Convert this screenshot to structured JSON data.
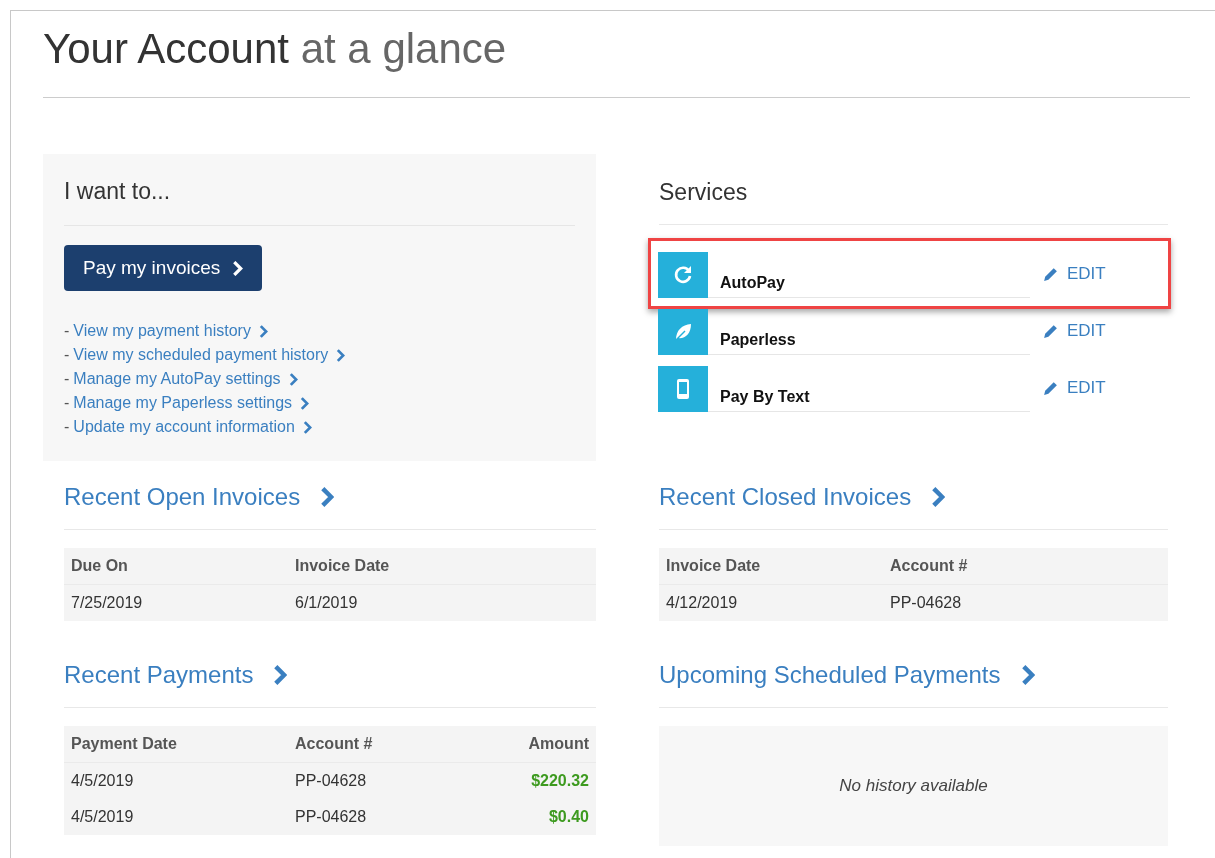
{
  "title": {
    "main": "Your Account",
    "rest": "at a glance"
  },
  "actions": {
    "heading": "I want to...",
    "primary_button": "Pay my invoices",
    "links": [
      {
        "prefix": "-",
        "label": "View my payment history"
      },
      {
        "prefix": "-",
        "label": "View my scheduled payment history"
      },
      {
        "prefix": "-",
        "label": "Manage my AutoPay settings"
      },
      {
        "prefix": "-",
        "label": "Manage my Paperless settings"
      },
      {
        "prefix": "-",
        "label": "Update my account information"
      }
    ]
  },
  "services": {
    "heading": "Services",
    "items": [
      {
        "kind": "refresh",
        "name": "AutoPay",
        "action": "EDIT",
        "highlighted": true
      },
      {
        "kind": "leaf",
        "name": "Paperless",
        "action": "EDIT",
        "highlighted": false
      },
      {
        "kind": "phone",
        "name": "Pay By Text",
        "action": "EDIT",
        "highlighted": false
      }
    ]
  },
  "sections": [
    {
      "title": "Recent Open Invoices",
      "columns": [
        {
          "label": "Due On",
          "kind": "text"
        },
        {
          "label": "Invoice Date",
          "kind": "text"
        }
      ],
      "rows": [
        [
          "7/25/2019",
          "6/1/2019"
        ]
      ]
    },
    {
      "title": "Recent Closed Invoices",
      "columns": [
        {
          "label": "Invoice Date",
          "kind": "text"
        },
        {
          "label": "Account #",
          "kind": "text"
        }
      ],
      "rows": [
        [
          "4/12/2019",
          "PP-04628"
        ]
      ]
    },
    {
      "title": "Recent Payments",
      "columns": [
        {
          "label": "Payment Date",
          "kind": "text"
        },
        {
          "label": "Account #",
          "kind": "text"
        },
        {
          "label": "Amount",
          "kind": "money"
        }
      ],
      "rows": [
        [
          "4/5/2019",
          "PP-04628",
          "$220.32"
        ],
        [
          "4/5/2019",
          "PP-04628",
          "$0.40"
        ]
      ]
    },
    {
      "title": "Upcoming Scheduled Payments",
      "empty_message": "No history available"
    }
  ]
}
